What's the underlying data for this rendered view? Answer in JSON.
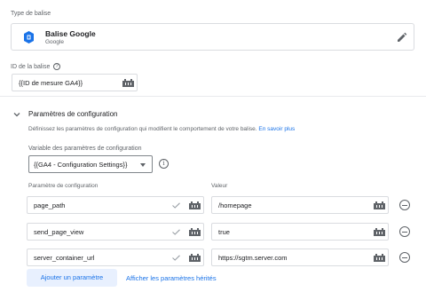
{
  "tag_type": {
    "label": "Type de balise",
    "name": "Balise Google",
    "vendor": "Google",
    "icon": "google-tag-icon",
    "edit_icon": "pencil-icon"
  },
  "tag_id": {
    "label": "ID de la balise",
    "help_icon": "?",
    "value": "{{ID de mesure GA4}}"
  },
  "config": {
    "title": "Paramètres de configuration",
    "description": "Définissez les paramètres de configuration qui modifient le comportement de votre balise.",
    "learn_more": "En savoir plus",
    "variable_label": "Variable des paramètres de configuration",
    "variable_value": "{{GA4 - Configuration Settings}}",
    "info_icon": "i",
    "param_header": "Paramètre de configuration",
    "value_header": "Valeur",
    "rows": [
      {
        "param": "page_path",
        "value": "/homepage"
      },
      {
        "param": "send_page_view",
        "value": "true"
      },
      {
        "param": "server_container_url",
        "value": "https://sgtm.server.com"
      }
    ],
    "add_button": "Ajouter un paramètre",
    "show_inherited": "Afficher les paramètres hérités"
  },
  "colors": {
    "accent": "#1a73e8",
    "border": "#dadce0",
    "muted_text": "#5f6368"
  }
}
